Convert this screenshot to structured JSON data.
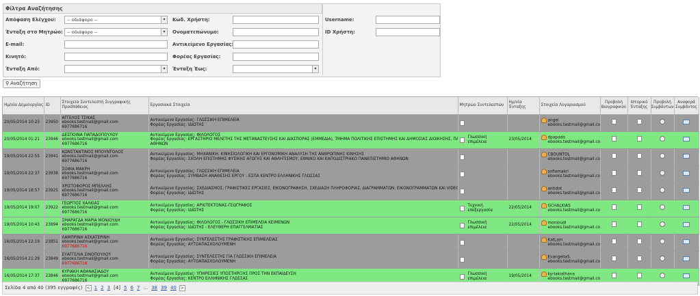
{
  "filters": {
    "title": "Φίλτρα Αναζήτησης",
    "decision_label": "Απόφαση Ελέγχου:",
    "decision_value": "-- οδιάφορο --",
    "registry_label": "Ένταξη στο Μητρώο:",
    "registry_value": "-- οδιάφορο --",
    "email_label": "E-mail:",
    "mobile_label": "Κινητό:",
    "from_label": "Ένταξη Από:",
    "usercode_label": "Κωδ. Χρήστη:",
    "name_label": "Ονοματεπώνυμο:",
    "object_label": "Αντικείμενο Εργασίας:",
    "body_label": "Φορέας Εργασίας:",
    "to_label": "Ένταξη Έως:",
    "username_label": "Username:",
    "userid_label": "ID Χρήστη:"
  },
  "search_button": "Αναζήτηση",
  "columns": [
    "Ημ/νία Δημιουργίας",
    "ID",
    "Στοιχεία Συντελεστή Συγγραφικής Προσπάθειας",
    "Εργασιακά Στοιχεία",
    "Μητρώο Συντελεστών",
    "Ημ/νία Ένταξης",
    "Στοιχεία Λογαριασμού",
    "Προβολή Βιογραφικού",
    "Ιστορικό Ένταξης",
    "Προβολή Συμβάντων",
    "Αναφορά Συμβάντος"
  ],
  "rows": [
    {
      "date": "20/05/2014 10:23",
      "id": "23950",
      "name": "ΑΓΓΕΛΟΣ ΤΣΙΚΑΣ",
      "email": "ebooks.testmail@gmail.com",
      "phone": "6977686716",
      "w1": "Αντικείμενο Εργασίας: ΓΛΩΣΣΙΚΗ ΕΠΙΜΕΛΕΙΑ",
      "w2": "Φορέας Εργασίας: ΙΔΙΩΤΗΣ",
      "w3": "",
      "reg": "",
      "regdate": "",
      "acc": "angel",
      "accmail": "ebooks.testmail@gmail.com",
      "green": false
    },
    {
      "date": "20/05/2014 01:21",
      "id": "23946",
      "name": "ΔΕΣΠΟΙΝΑ ΠΑΠΑΔΟΠΟΥΛΟΥ",
      "email": "ebooks.testmail@gmail.com",
      "phone": "6977686716",
      "w1": "Αντικείμενο Εργασίας: ΦΙΛΟΛΟΓΟΣ",
      "w2": "Φορέας Εργασίας: ΕΡΓΑΣΤΗΡΙΟ ΜΕΛΕΤΗΣ ΤΗΣ ΜΕΤΑΝΑΣΤΕΥΣΗΣ ΚΑΙ ΔΙΑΣΠΟΡΑΣ (ΕΜΜΕΔΙΑ), ΤΜΗΜΑ ΠΟΛΙΤΙΚΗΣ ΕΠΙΣΤΗΜΗΣ ΚΑΙ ΔΗΜΟΣΙΑΣ ΔΙΟΙΚΗΣΗΣ, ΠΑΝΕΠΙΣΤΗΜΙΟ",
      "w3": "ΑΘΗΝΩΝ",
      "reg": "Γλωσσική επιμέλεια",
      "regdate": "23/05/2014",
      "acc": "dpapado",
      "accmail": "ebooks.testmail@gmail.com",
      "green": true
    },
    {
      "date": "19/05/2014 22:55",
      "id": "23941",
      "name": "ΚΩΝΣΤΑΝΤΙΝΟΣ ΜΠΟΥΝΤΟΛΟΣ",
      "email": "ebooks.testmail@gmail.com",
      "phone": "6977686716",
      "w1": "Αντικείμενο Εργασίας: ΜΗΧΑΝΙΚΗ, ΚΙΝΗΣΙΟΛΟΓΙΚΗ ΚΑΙ ΕΡΓΟΝΟΜΙΚΗ ΑΝΑΛΥΣΗ ΤΗΣ ΑΝΘΡΩΠΙΝΗΣ ΚΙΝΗΣΗΣ",
      "w2": "Φορέας Εργασίας: ΣΧΟΛΗ ΕΠΙΣΤΗΜΗΣ ΦΥΣΙΚΗΣ ΑΓΩΓΗΣ ΚΑΙ ΑΘΛΗΤΙΣΜΟΥ, ΕΘΝΙΚΟ ΚΑΙ ΚΑΠΟΔΙΣΤΡΙΑΚΟ ΠΑΝΕΠΙΣΤΗΜΙΟ ΑΘΗΝΩΝ",
      "w3": "",
      "reg": "",
      "regdate": "",
      "acc": "CBOUNTOL",
      "accmail": "ebooks.testmail@gmail.com",
      "green": false
    },
    {
      "date": "19/05/2014 22:37",
      "id": "23938",
      "name": "ΣΟΦΙΑ ΜΑΚΡΗ",
      "email": "ebooks.testmail@gmail.com",
      "phone": "6977686716",
      "w1": "Αντικείμενο Εργασίας: ΓΛΩΣΣΙΚΗ ΕΠΙΜΕΛΕΙΑ",
      "w2": "Φορέας Εργασίας: ΣΥΜΒΑΣΗ ΑΝΑΘΕΣΗΣ ΕΡΓΟΥ - ΕΣΠΑ ΚΕΝΤΡΟ ΕΛΛΗΝΙΚΗΣ ΓΛΩΣΣΑΣ",
      "w3": "",
      "reg": "",
      "regdate": "",
      "acc": "sofiamakri",
      "accmail": "ebooks.testmail@gmail.com",
      "green": false
    },
    {
      "date": "19/05/2014 18:57",
      "id": "23925",
      "name": "ΧΡΙΣΤΟΦΟΡΟΣ ΜΠΕΛΛΗΣ",
      "email": "ebooks.testmail@gmail.com",
      "phone": "6977686716",
      "w1": "Αντικείμενο Εργασίας: ΣΧΕΔΙΑΣΜΟΣ, ΓΡΑΦΙΣΤΙΚΕΣ ΕΡΓΑΣΙΕΣ, ΕΙΚΟΝΟΓΡΑΦΗΣΗ, ΣΧΕΔΙΑΣΗ ΠΛΗΡΟΦΟΡΙΑΣ, ΔΙΑΓΡΑΜΜΑΤΩΝ, ΕΙΚΟΝΟΓΡΑΜΜΑΤΩΝ ΚΑΙ VIDEO",
      "w2": "Φορέας Εργασίας: ΙΔΙΩΤΗΣ",
      "w3": "",
      "reg": "",
      "regdate": "",
      "acc": "antidot",
      "accmail": "ebooks.testmail@gmail.com",
      "green": false
    },
    {
      "date": "19/05/2014 19:07",
      "id": "23922",
      "name": "ΓΕΩΡΓΙΟΣ ΧΑΛΚΙΑΣ",
      "email": "ebooks.testmail@gmail.com",
      "phone": "6977686716",
      "w1": "Αντικείμενο Εργασίας: ΑΡΧΙΤΕΚΤΟΝΑΣ-ΓΕΩΓΡΑΦΟΣ",
      "w2": "Φορέας Εργασίας: ΙΔΙΩΤΗΣ",
      "w3": "",
      "reg": "Τεχνική επεξεργασία",
      "regdate": "22/05/2014",
      "acc": "GCHALKIAS",
      "accmail": "ebooks.testmail@gmail.com",
      "green": true
    },
    {
      "date": "19/05/2014 10:43",
      "id": "23894",
      "name": "ΣΜΑΡΑΓΔΑ ΜΑΡΙΑ ΜΟΝΙΟΥΔΗ",
      "email": "ebooks.testmail@gmail.com",
      "phone": "6977686716",
      "w1": "Αντικείμενο Εργασίας: ΦΙΛΟΛΟΓΟΣ - ΓΛΩΣΣΙΚΗ ΕΠΙΜΕΛΕΙΑ ΚΕΙΜΕΝΩΝ",
      "w2": "Φορέας Εργασίας: ΙΔΙΩΤΗΣ - ΕΛΕΥΘΕΡΗ ΕΠΑΓΓΕΛΜΑΤΙΑΣ",
      "w3": "",
      "reg": "Γλωσσική επιμέλεια",
      "regdate": "22/05/2014",
      "acc": "monioudi",
      "accmail": "ebooks.testmail@gmail.com",
      "green": true
    },
    {
      "date": "16/05/2014 22:19",
      "id": "23851",
      "name": "ΛΑΜΠΡΙΝΗ ΑΣΚΑΤΕΡΙΝΗ",
      "email": "ebooks.testmail@gmail.com",
      "phone": "6977686716",
      "w1": "Αντικείμενο Εργασίας: ΣΥΝΤΕΛΕΣΤΗΣ ΓΡΑΦΙΣΤΙΚΗΣ ΕΠΙΜΕΛΕΙΑΣ",
      "w2": "Φορέας Εργασίας: ΑΥΤΟΑΠΑΣΧΟΛΟΥΜΕΝΗ",
      "w3": "",
      "reg": "",
      "regdate": "",
      "acc": "KatLam",
      "accmail": "ebooks.testmail@gmail.com",
      "green": false,
      "redphone": true
    },
    {
      "date": "16/05/2014 21:29",
      "id": "23849",
      "name": "ΕΥΑΓΓΕΛΙΑ ΣΙΝΟΠΟΥΛΟΥ",
      "email": "ebooks.testmail@gmail.com",
      "phone": "6977686716",
      "w1": "Αντικείμενο Εργασίας: ΣΥΝΤΕΛΕΣΤΗΣ ΓΙΑ ΓΛΩΣΣΙΚΗ ΕΠΙΜΕΛΕΙΑ",
      "w2": "Φορέας Εργασίας: ΑΥΤΟΑΠΑΣΧΟΛΟΥΜΕΝΗ",
      "w3": "",
      "reg": "",
      "regdate": "",
      "acc": "EvangeliaS.",
      "accmail": "ebooks.testmail@gmail.com",
      "green": false,
      "redphone": true
    },
    {
      "date": "16/05/2014 17:37",
      "id": "23846",
      "name": "ΚΥΡΙΑΚΗ ΑΘΑΝΑΣΙΑΔΟΥ",
      "email": "ebooks.testmail@gmail.com",
      "phone": "6977686716",
      "w1": "Αντικείμενο Εργασίας: ΥΠΗΡΕΣΙΕΣ ΥΠΟΣΤΗΡΙΞΗΣ ΠΡΟΣ ΤΗΝ ΕΚΠΑΙΔΕΥΣΗ",
      "w2": "Φορέας Εργασίας: ΚΕΝΤΡΟ ΕΛΛΗΝΙΚΗΣ ΓΛΩΣΣΑΣ",
      "w3": "",
      "reg": "Γλωσσική επιμέλεια",
      "regdate": "19/05/2014",
      "acc": "kyriakiathana",
      "accmail": "ebooks.testmail@gmail.com",
      "green": true
    }
  ],
  "pager": {
    "summary": "Σελίδα 4 από 40 (395 εγγραφές)",
    "pages": [
      "1",
      "2",
      "3",
      "[4]",
      "5",
      "6",
      "7",
      "...",
      "38",
      "39",
      "40"
    ],
    "prev": "<",
    "next": ">"
  }
}
